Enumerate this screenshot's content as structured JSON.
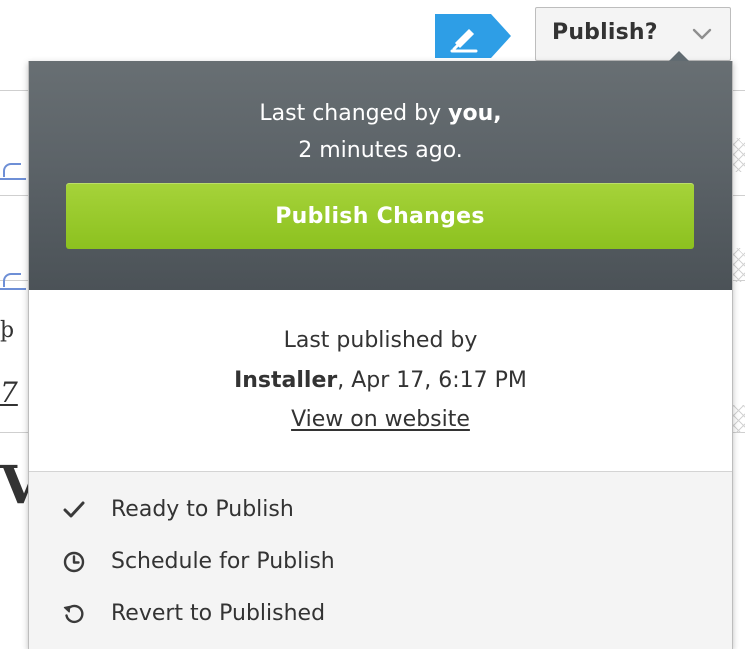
{
  "toolbar": {
    "edit_icon": "pencil-icon",
    "publish_toggle_label": "Publish?",
    "chevron_icon": "chevron-down-icon",
    "edit_button_color": "#2e9ee6"
  },
  "publish_menu": {
    "changed_prefix": "Last changed by",
    "changed_by": "you,",
    "changed_when": "2 minutes ago.",
    "publish_changes_label": "Publish Changes",
    "published_prefix": "Last published by",
    "published_by": "Installer",
    "published_when": ", Apr 17, 6:17 PM",
    "view_link_label": "View on website",
    "actions": [
      {
        "label": "Ready to Publish",
        "icon": "checkmark-icon"
      },
      {
        "label": "Schedule for Publish",
        "icon": "clock-icon"
      },
      {
        "label": "Revert to Published",
        "icon": "revert-icon"
      }
    ],
    "colors": {
      "publish_button": "#96c928",
      "draft_header": "#5c6368"
    }
  },
  "background": {
    "partial_glyph_1": "þ",
    "partial_glyph_2": "7",
    "partial_glyph_3": "V"
  }
}
